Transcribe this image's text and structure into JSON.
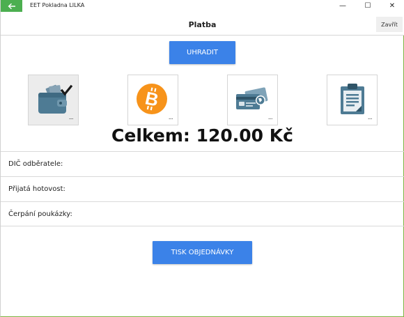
{
  "window": {
    "app_title": "EET Pokladna LILKA",
    "controls": {
      "minimize": "—",
      "maximize": "☐",
      "close": "✕"
    }
  },
  "header": {
    "title": "Platba",
    "close_label": "Zavřít"
  },
  "actions": {
    "pay_label": "UHRADIT",
    "print_label": "TISK OBJEDNÁVKY"
  },
  "payment_methods": [
    {
      "icon": "wallet-check-icon",
      "selected": true,
      "more": "..."
    },
    {
      "icon": "bitcoin-icon",
      "selected": false,
      "more": "..."
    },
    {
      "icon": "payment-cards-icon",
      "selected": false,
      "more": "..."
    },
    {
      "icon": "clipboard-invoice-icon",
      "selected": false,
      "more": "..."
    }
  ],
  "total": "Celkem: 120.00 Kč",
  "fields": [
    {
      "label": "DIČ odběratele:"
    },
    {
      "label": "Přijatá hotovost:"
    },
    {
      "label": "Čerpání poukázky:"
    }
  ],
  "colors": {
    "accent": "#3b82e8",
    "titlebar_back": "#4caf50",
    "bitcoin": "#f7931a",
    "icon_slate": "#4e7b94"
  }
}
